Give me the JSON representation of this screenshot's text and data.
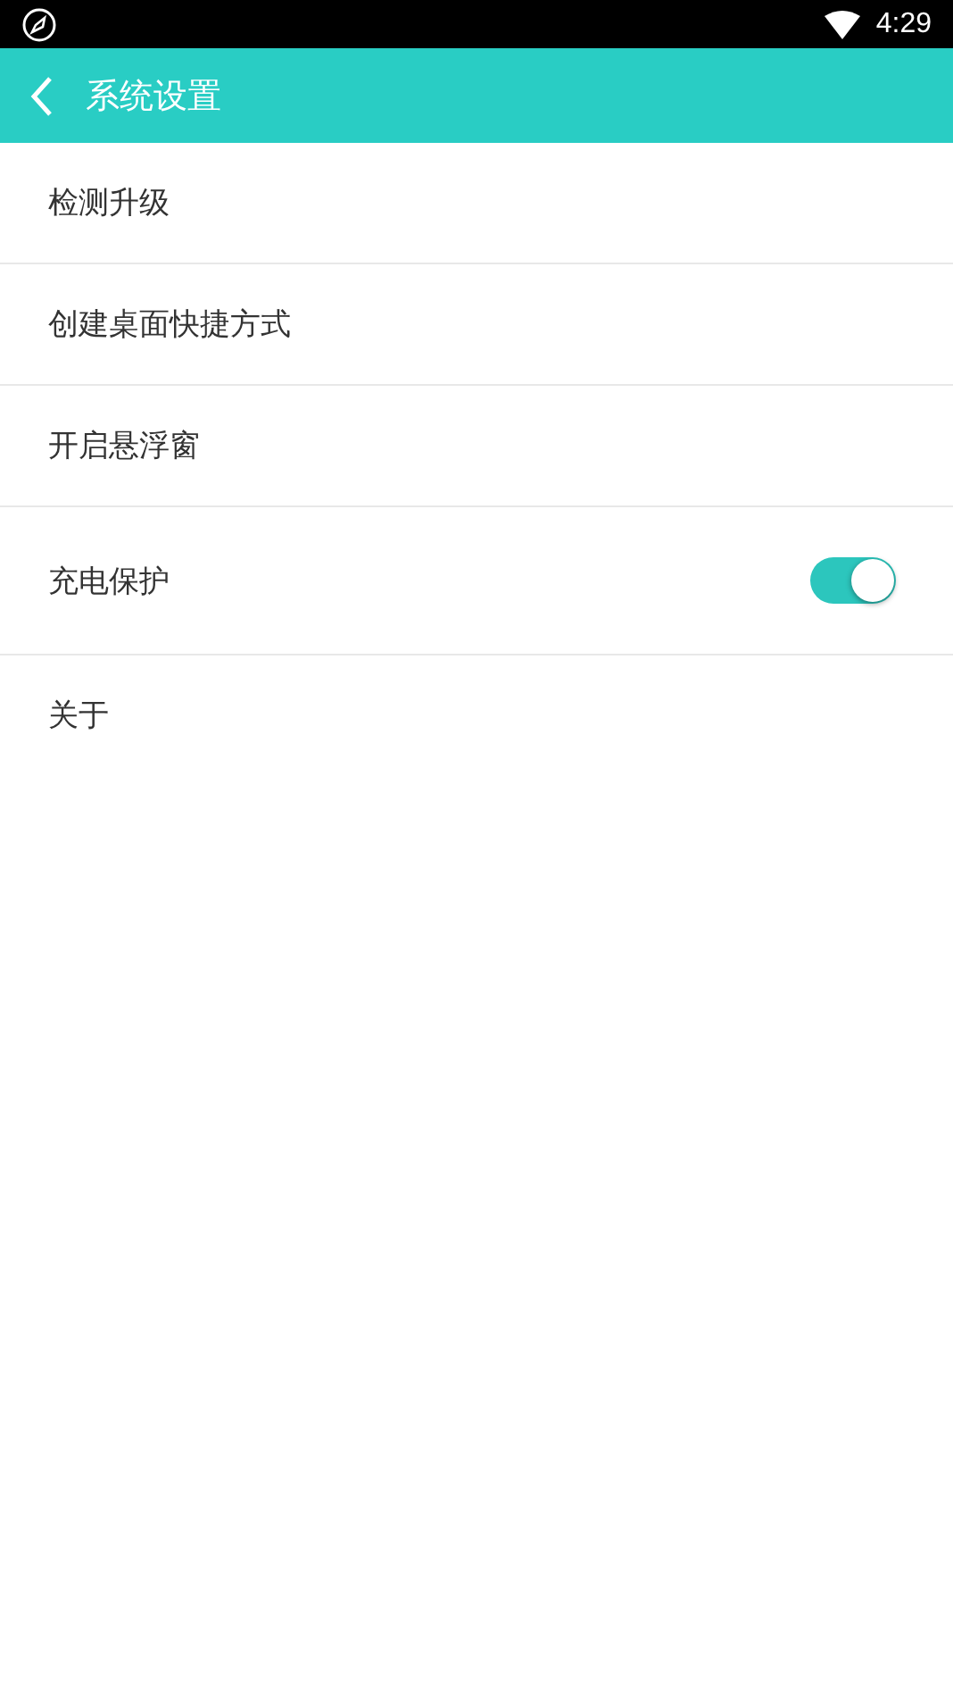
{
  "status_bar": {
    "time": "4:29"
  },
  "header": {
    "title": "系统设置"
  },
  "settings": [
    {
      "kind": "link",
      "label": "检测升级"
    },
    {
      "kind": "link",
      "label": "创建桌面快捷方式"
    },
    {
      "kind": "link",
      "label": "开启悬浮窗"
    },
    {
      "kind": "toggle",
      "label": "充电保护",
      "on": true
    },
    {
      "kind": "link",
      "label": "关于"
    }
  ]
}
